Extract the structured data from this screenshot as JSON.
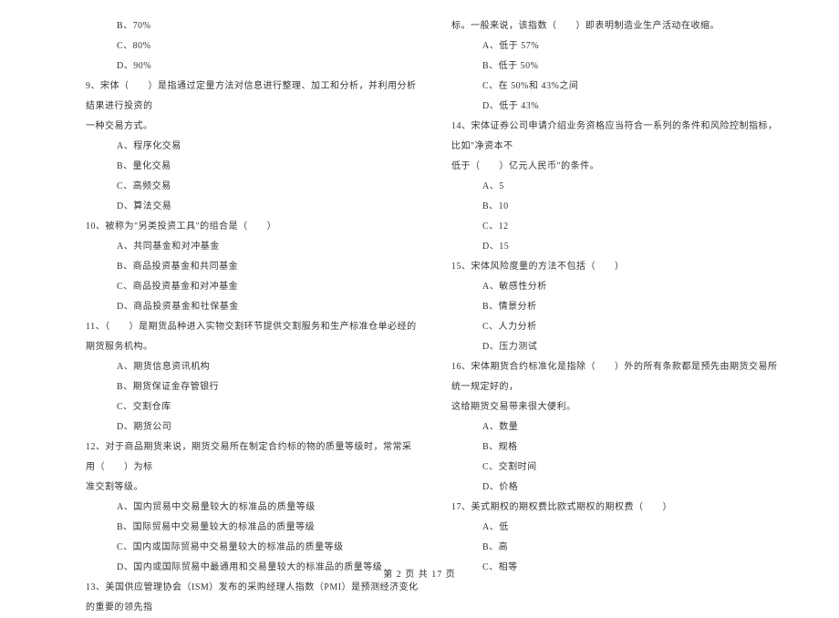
{
  "left": {
    "q8_opts": {
      "b": "B、70%",
      "c": "C、80%",
      "d": "D、90%"
    },
    "q9": {
      "line1": "9、宋体（　　）是指通过定量方法对信息进行整理、加工和分析，并利用分析结果进行投资的",
      "line2": "一种交易方式。",
      "a": "A、程序化交易",
      "b": "B、量化交易",
      "c": "C、高频交易",
      "d": "D、算法交易"
    },
    "q10": {
      "line1": "10、被称为\"另类投资工具\"的组合是（　　）",
      "a": "A、共同基金和对冲基金",
      "b": "B、商品投资基金和共同基金",
      "c": "C、商品投资基金和对冲基金",
      "d": "D、商品投资基金和社保基金"
    },
    "q11": {
      "line1": "11、（　　）是期货品种进入实物交割环节提供交割服务和生产标准仓单必经的期货服务机构。",
      "a": "A、期货信息资讯机构",
      "b": "B、期货保证金存管银行",
      "c": "C、交割仓库",
      "d": "D、期货公司"
    },
    "q12": {
      "line1": "12、对于商品期货来说，期货交易所在制定合约标的物的质量等级时，常常采用（　　）为标",
      "line2": "准交割等级。",
      "a": "A、国内贸易中交易量较大的标准品的质量等级",
      "b": "B、国际贸易中交易量较大的标准品的质量等级",
      "c": "C、国内或国际贸易中交易量较大的标准品的质量等级",
      "d": "D、国内或国际贸易中最通用和交易量较大的标准品的质量等级"
    },
    "q13": {
      "line1": "13、美国供应管理协会（ISM）发布的采购经理人指数（PMI）是预测经济变化的重要的领先指"
    }
  },
  "right": {
    "q13_cont": {
      "line1": "标。一般来说，该指数（　　）即表明制造业生产活动在收缩。",
      "a": "A、低于 57%",
      "b": "B、低于 50%",
      "c": "C、在 50%和 43%之间",
      "d": "D、低于 43%"
    },
    "q14": {
      "line1": "14、宋体证券公司申请介绍业务资格应当符合一系列的条件和风险控制指标，比如\"净资本不",
      "line2": "低于（　　）亿元人民币\"的条件。",
      "a": "A、5",
      "b": "B、10",
      "c": "C、12",
      "d": "D、15"
    },
    "q15": {
      "line1": "15、宋体风险度量的方法不包括（　　）",
      "a": "A、敏感性分析",
      "b": "B、情景分析",
      "c": "C、人力分析",
      "d": "D、压力测试"
    },
    "q16": {
      "line1": "16、宋体期货合约标准化是指除（　　）外的所有条款都是预先由期货交易所统一规定好的，",
      "line2": "这给期货交易带来很大便利。",
      "a": "A、数量",
      "b": "B、规格",
      "c": "C、交割时间",
      "d": "D、价格"
    },
    "q17": {
      "line1": "17、美式期权的期权费比欧式期权的期权费（　　）",
      "a": "A、低",
      "b": "B、高",
      "c": "C、相等"
    }
  },
  "footer": "第 2 页 共 17 页"
}
